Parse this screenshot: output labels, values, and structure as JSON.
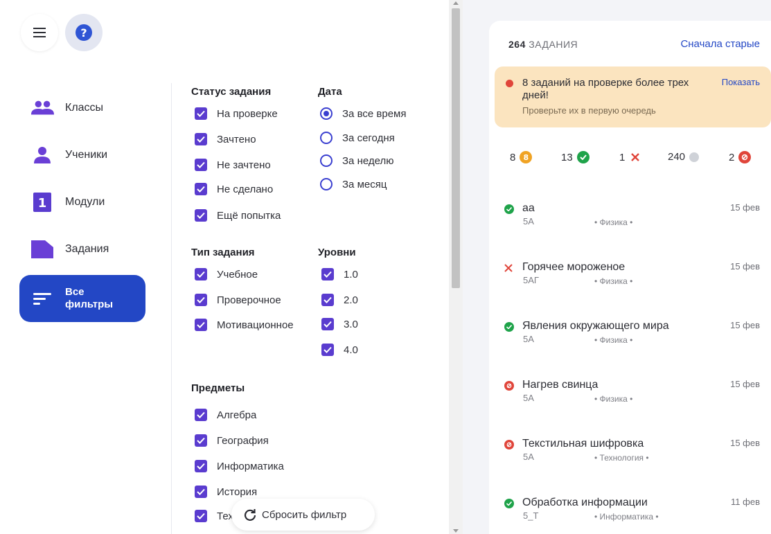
{
  "colors": {
    "accent": "#2347c5",
    "checkbox": "#5a3ccf",
    "warning_bg": "#fbe4bf",
    "ok": "#1fa34a",
    "fail": "#e0453a",
    "review": "#f0a324",
    "none": "#cfd2d8"
  },
  "nav": [
    {
      "label": "Классы",
      "icon": "classes-icon"
    },
    {
      "label": "Ученики",
      "icon": "student-icon"
    },
    {
      "label": "Модули",
      "icon": "modules-icon"
    },
    {
      "label": "Задания",
      "icon": "assignments-icon"
    },
    {
      "label": "Все фильтры",
      "icon": "filter-icon",
      "active": true
    }
  ],
  "filters": {
    "status": {
      "title": "Статус задания",
      "options": [
        "На проверке",
        "Зачтено",
        "Не зачтено",
        "Не сделано",
        "Ещё попытка"
      ]
    },
    "date": {
      "title": "Дата",
      "options": [
        "За все время",
        "За сегодня",
        "За неделю",
        "За месяц"
      ],
      "selected": "За все время"
    },
    "type": {
      "title": "Тип задания",
      "options": [
        "Учебное",
        "Проверочное",
        "Мотивационное"
      ]
    },
    "levels": {
      "title": "Уровни",
      "options": [
        "1.0",
        "2.0",
        "3.0",
        "4.0"
      ]
    },
    "subjects": {
      "title": "Предметы",
      "options": [
        "Алгебра",
        "География",
        "Информатика",
        "История",
        "Тех"
      ]
    },
    "reset_label": "Сбросить фильтр"
  },
  "tasks_panel": {
    "count": "264",
    "count_word": "ЗАДАНИЯ",
    "sort_label": "Сначала старые",
    "warning": {
      "title": "8 заданий на проверке более трех дней!",
      "subtitle": "Проверьте их в первую очередь",
      "action": "Показать"
    },
    "stats": [
      {
        "value": "8",
        "icon": "review-icon"
      },
      {
        "value": "13",
        "icon": "check-icon"
      },
      {
        "value": "1",
        "icon": "cross-icon"
      },
      {
        "value": "240",
        "icon": "pending-icon"
      },
      {
        "value": "2",
        "icon": "redo-icon"
      }
    ],
    "tasks": [
      {
        "name": "аа",
        "class": "5А",
        "subject": "• Физика •",
        "date": "15 фев",
        "status": "passed"
      },
      {
        "name": "Горячее мороженое",
        "class": "5АГ",
        "subject": "• Физика •",
        "date": "15 фев",
        "status": "failed"
      },
      {
        "name": "Явления окружающего мира",
        "class": "5А",
        "subject": "• Физика •",
        "date": "15 фев",
        "status": "passed"
      },
      {
        "name": "Нагрев свинца",
        "class": "5А",
        "subject": "• Физика •",
        "date": "15 фев",
        "status": "retry"
      },
      {
        "name": "Текстильная шифровка",
        "class": "5А",
        "subject": "• Технология •",
        "date": "15 фев",
        "status": "retry"
      },
      {
        "name": "Обработка информации",
        "class": "5_Т",
        "subject": "• Информатика •",
        "date": "11 фев",
        "status": "passed"
      }
    ]
  }
}
